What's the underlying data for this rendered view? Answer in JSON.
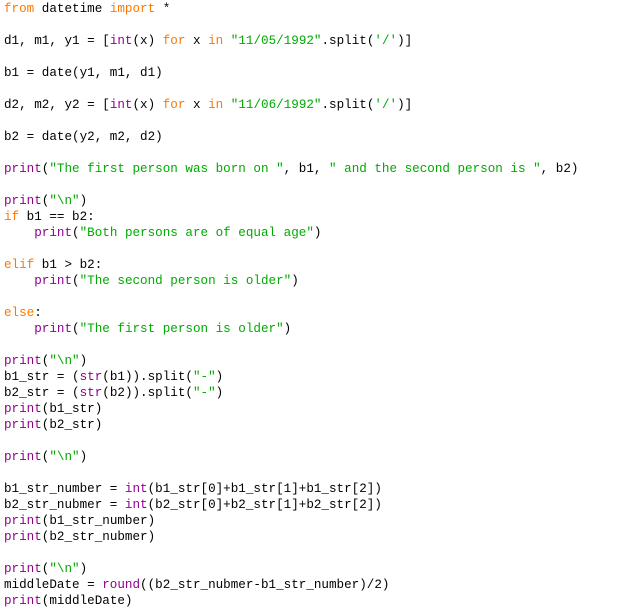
{
  "editor": {
    "language": "python",
    "colors": {
      "keyword": "#ff7700",
      "builtin": "#900090",
      "string": "#00aa00",
      "plain": "#000000",
      "background": "#ffffff"
    },
    "lines": [
      {
        "row": 0,
        "tokens": [
          [
            "kw",
            "from"
          ],
          [
            "pl",
            " datetime "
          ],
          [
            "kw",
            "import"
          ],
          [
            "pl",
            " *"
          ]
        ]
      },
      {
        "row": 2,
        "tokens": [
          [
            "pl",
            "d1, m1, y1 = ["
          ],
          [
            "bi",
            "int"
          ],
          [
            "pl",
            "(x) "
          ],
          [
            "kw",
            "for"
          ],
          [
            "pl",
            " x "
          ],
          [
            "kw",
            "in"
          ],
          [
            "pl",
            " "
          ],
          [
            "st",
            "\"11/05/1992\""
          ],
          [
            "pl",
            ".split("
          ],
          [
            "st",
            "'/'"
          ],
          [
            "pl",
            ")]"
          ]
        ]
      },
      {
        "row": 4,
        "tokens": [
          [
            "pl",
            "b1 = date(y1, m1, d1)"
          ]
        ]
      },
      {
        "row": 6,
        "tokens": [
          [
            "pl",
            "d2, m2, y2 = ["
          ],
          [
            "bi",
            "int"
          ],
          [
            "pl",
            "(x) "
          ],
          [
            "kw",
            "for"
          ],
          [
            "pl",
            " x "
          ],
          [
            "kw",
            "in"
          ],
          [
            "pl",
            " "
          ],
          [
            "st",
            "\"11/06/1992\""
          ],
          [
            "pl",
            ".split("
          ],
          [
            "st",
            "'/'"
          ],
          [
            "pl",
            ")]"
          ]
        ]
      },
      {
        "row": 8,
        "tokens": [
          [
            "pl",
            "b2 = date(y2, m2, d2)"
          ]
        ]
      },
      {
        "row": 10,
        "tokens": [
          [
            "bi",
            "print"
          ],
          [
            "pl",
            "("
          ],
          [
            "st",
            "\"The first person was born on \""
          ],
          [
            "pl",
            ", b1, "
          ],
          [
            "st",
            "\" and the second person is \""
          ],
          [
            "pl",
            ", b2)"
          ]
        ]
      },
      {
        "row": 12,
        "tokens": [
          [
            "bi",
            "print"
          ],
          [
            "pl",
            "("
          ],
          [
            "st",
            "\"\\n\""
          ],
          [
            "pl",
            ")"
          ]
        ]
      },
      {
        "row": 13,
        "tokens": [
          [
            "kw",
            "if"
          ],
          [
            "pl",
            " b1 == b2:"
          ]
        ]
      },
      {
        "row": 14,
        "tokens": [
          [
            "pl",
            "    "
          ],
          [
            "bi",
            "print"
          ],
          [
            "pl",
            "("
          ],
          [
            "st",
            "\"Both persons are of equal age\""
          ],
          [
            "pl",
            ")"
          ]
        ]
      },
      {
        "row": 16,
        "tokens": [
          [
            "kw",
            "elif"
          ],
          [
            "pl",
            " b1 > b2:"
          ]
        ]
      },
      {
        "row": 17,
        "tokens": [
          [
            "pl",
            "    "
          ],
          [
            "bi",
            "print"
          ],
          [
            "pl",
            "("
          ],
          [
            "st",
            "\"The second person is older\""
          ],
          [
            "pl",
            ")"
          ]
        ]
      },
      {
        "row": 19,
        "tokens": [
          [
            "kw",
            "else"
          ],
          [
            "pl",
            ":"
          ]
        ]
      },
      {
        "row": 20,
        "tokens": [
          [
            "pl",
            "    "
          ],
          [
            "bi",
            "print"
          ],
          [
            "pl",
            "("
          ],
          [
            "st",
            "\"The first person is older\""
          ],
          [
            "pl",
            ")"
          ]
        ]
      },
      {
        "row": 22,
        "tokens": [
          [
            "bi",
            "print"
          ],
          [
            "pl",
            "("
          ],
          [
            "st",
            "\"\\n\""
          ],
          [
            "pl",
            ")"
          ]
        ]
      },
      {
        "row": 23,
        "tokens": [
          [
            "pl",
            "b1_str = ("
          ],
          [
            "bi",
            "str"
          ],
          [
            "pl",
            "(b1)).split("
          ],
          [
            "st",
            "\"-\""
          ],
          [
            "pl",
            ")"
          ]
        ]
      },
      {
        "row": 24,
        "tokens": [
          [
            "pl",
            "b2_str = ("
          ],
          [
            "bi",
            "str"
          ],
          [
            "pl",
            "(b2)).split("
          ],
          [
            "st",
            "\"-\""
          ],
          [
            "pl",
            ")"
          ]
        ]
      },
      {
        "row": 25,
        "tokens": [
          [
            "bi",
            "print"
          ],
          [
            "pl",
            "(b1_str)"
          ]
        ]
      },
      {
        "row": 26,
        "tokens": [
          [
            "bi",
            "print"
          ],
          [
            "pl",
            "(b2_str)"
          ]
        ]
      },
      {
        "row": 28,
        "tokens": [
          [
            "bi",
            "print"
          ],
          [
            "pl",
            "("
          ],
          [
            "st",
            "\"\\n\""
          ],
          [
            "pl",
            ")"
          ]
        ]
      },
      {
        "row": 30,
        "tokens": [
          [
            "pl",
            "b1_str_number = "
          ],
          [
            "bi",
            "int"
          ],
          [
            "pl",
            "(b1_str[0]+b1_str[1]+b1_str[2])"
          ]
        ]
      },
      {
        "row": 31,
        "tokens": [
          [
            "pl",
            "b2_str_nubmer = "
          ],
          [
            "bi",
            "int"
          ],
          [
            "pl",
            "(b2_str[0]+b2_str[1]+b2_str[2])"
          ]
        ]
      },
      {
        "row": 32,
        "tokens": [
          [
            "bi",
            "print"
          ],
          [
            "pl",
            "(b1_str_number)"
          ]
        ]
      },
      {
        "row": 33,
        "tokens": [
          [
            "bi",
            "print"
          ],
          [
            "pl",
            "(b2_str_nubmer)"
          ]
        ]
      },
      {
        "row": 35,
        "tokens": [
          [
            "bi",
            "print"
          ],
          [
            "pl",
            "("
          ],
          [
            "st",
            "\"\\n\""
          ],
          [
            "pl",
            ")"
          ]
        ]
      },
      {
        "row": 36,
        "tokens": [
          [
            "pl",
            "middleDate = "
          ],
          [
            "bi",
            "round"
          ],
          [
            "pl",
            "((b2_str_nubmer-b1_str_number)/2)"
          ]
        ]
      },
      {
        "row": 37,
        "tokens": [
          [
            "bi",
            "print"
          ],
          [
            "pl",
            "(middleDate)"
          ]
        ]
      }
    ]
  }
}
